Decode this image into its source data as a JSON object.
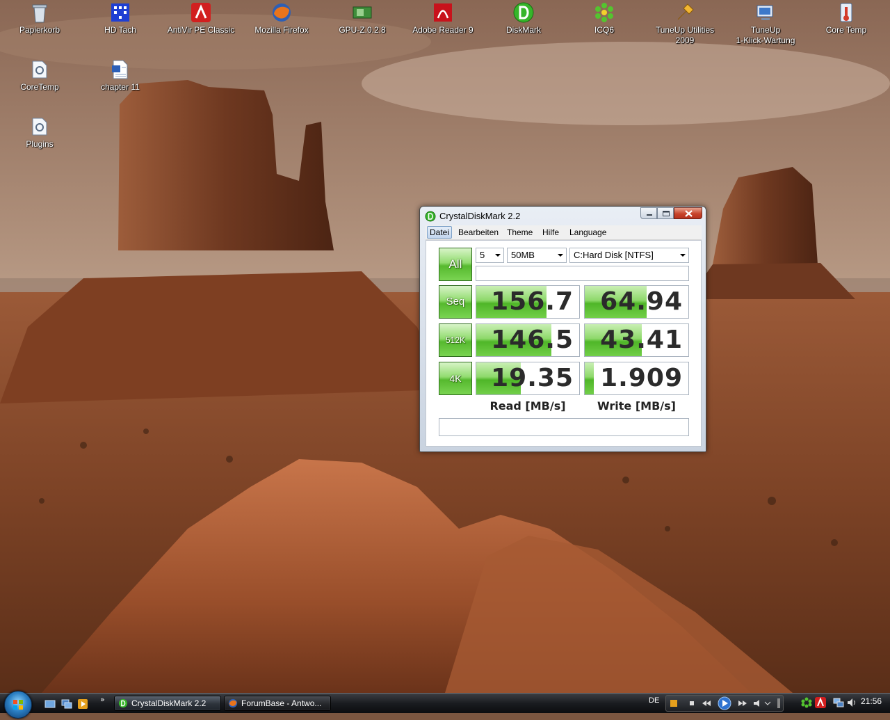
{
  "desktop": {
    "icons": [
      {
        "label": "Papierkorb",
        "icon": "recycle-bin-icon"
      },
      {
        "label": "HD Tach",
        "icon": "hd-tach-icon"
      },
      {
        "label": "AntiVir PE Classic",
        "icon": "antivir-icon"
      },
      {
        "label": "Mozilla Firefox",
        "icon": "firefox-icon"
      },
      {
        "label": "GPU-Z.0.2.8",
        "icon": "gpu-z-icon"
      },
      {
        "label": "Adobe Reader 9",
        "icon": "adobe-reader-icon"
      },
      {
        "label": "DiskMark",
        "icon": "diskmark-icon"
      },
      {
        "label": "ICQ6",
        "icon": "icq-icon"
      },
      {
        "label": "TuneUp Utilities 2009",
        "icon": "tuneup-icon"
      },
      {
        "label": "TuneUp\n1-Klick-Wartung",
        "icon": "tuneup-1click-icon"
      },
      {
        "label": "Core Temp",
        "icon": "core-temp-icon"
      },
      {
        "label": "CoreTemp",
        "icon": "folder-icon"
      },
      {
        "label": "chapter 11",
        "icon": "word-document-icon"
      },
      {
        "label": "Plugins",
        "icon": "folder-icon"
      }
    ]
  },
  "window": {
    "title": "CrystalDiskMark 2.2",
    "menu": [
      "Datei",
      "Bearbeiten",
      "Theme",
      "Hilfe",
      "Language"
    ],
    "controls": {
      "all_label": "All",
      "count": "5",
      "size": "50MB",
      "drive": "C:Hard Disk [NTFS]"
    },
    "tests": [
      {
        "label": "Seq",
        "read": "156.7",
        "write": "64.94",
        "read_fill": 0.68,
        "write_fill": 0.6
      },
      {
        "label": "512K",
        "read": "146.5",
        "write": "43.41",
        "read_fill": 0.73,
        "write_fill": 0.55
      },
      {
        "label": "4K",
        "read": "19.35",
        "write": "1.909",
        "read_fill": 0.43,
        "write_fill": 0.09
      }
    ],
    "read_label": "Read [MB/s]",
    "write_label": "Write [MB/s]",
    "accent": "#56b92e"
  },
  "taskbar": {
    "tasks": [
      {
        "label": "CrystalDiskMark 2.2",
        "active": true
      },
      {
        "label": "ForumBase - Antwo...",
        "active": false
      }
    ],
    "language": "DE",
    "clock": "21:56"
  }
}
